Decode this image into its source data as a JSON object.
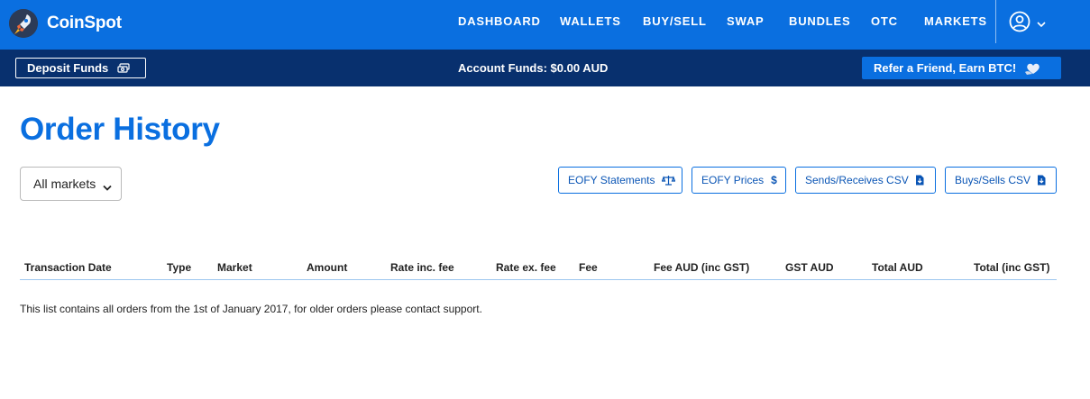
{
  "brand": {
    "name": "CoinSpot",
    "accent": "#0a6fe0",
    "subbar": "#08306e"
  },
  "nav": {
    "links": [
      "DASHBOARD",
      "WALLETS",
      "BUY/SELL",
      "SWAP",
      "BUNDLES",
      "OTC",
      "MARKETS"
    ],
    "user_icon": "user-circle-icon",
    "chevron_icon": "chevron-down-icon"
  },
  "subbar": {
    "deposit_label": "Deposit Funds",
    "deposit_icon": "cash-stack-icon",
    "account_funds": "Account Funds: $0.00 AUD",
    "refer_label": "Refer a Friend, Earn BTC!",
    "refer_icon": "heart-hand-icon"
  },
  "page": {
    "title": "Order History",
    "market_select": {
      "value": "All markets"
    },
    "actions": [
      {
        "label": "EOFY Statements",
        "icon": "scale-icon"
      },
      {
        "label": "EOFY Prices",
        "icon": "dollar-icon"
      },
      {
        "label": "Sends/Receives CSV",
        "icon": "file-download-icon"
      },
      {
        "label": "Buys/Sells CSV",
        "icon": "file-download-icon"
      }
    ],
    "table": {
      "columns": [
        "Transaction Date",
        "Type",
        "Market",
        "Amount",
        "Rate inc. fee",
        "Rate ex. fee",
        "Fee",
        "Fee AUD (inc GST)",
        "GST AUD",
        "Total AUD",
        "Total (inc GST)"
      ],
      "rows": []
    },
    "notice": "This list contains all orders from the 1st of January 2017, for older orders please contact support."
  }
}
